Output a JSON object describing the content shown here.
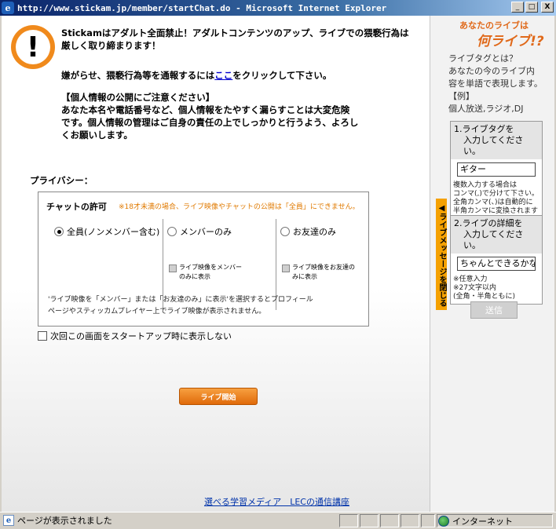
{
  "window": {
    "title": "http://www.stickam.jp/member/startChat.do - Microsoft Internet Explorer",
    "minimize": "_",
    "maximize": "□",
    "close": "X"
  },
  "notice": {
    "headline_1": "Stickamはアダルト全面禁止！アダルトコンテンツのアップ、ライブでの猥褻行為は",
    "headline_2": "厳しく取り締まります！",
    "report_before": "嫌がらせ、猥褻行為等を通報するには",
    "report_link": "ここ",
    "report_after": "をクリックして下さい。",
    "privacy_heading": "【個人情報の公開にご注意ください】",
    "privacy_1": "あなた本名や電話番号など、個人情報をたやすく漏らすことは大変危険",
    "privacy_2": "です。個人情報の管理はご自身の責任の上でしっかりと行うよう、よろし",
    "privacy_3": "くお願いします。"
  },
  "privacy": {
    "title": "プライバシー：",
    "chat_permission": "チャットの許可",
    "age_note": "※18才未満の場合、ライブ映像やチャットの公開は「全員」にできません。",
    "options": [
      {
        "label": "全員(ノンメンバー含む)",
        "selected": true
      },
      {
        "label": "メンバーのみ",
        "selected": false
      },
      {
        "label": "お友達のみ",
        "selected": false
      }
    ],
    "sub_members_1": "ライブ映像をメンバー",
    "sub_members_2": "のみに表示",
    "sub_friends_1": "ライブ映像をお友達の",
    "sub_friends_2": "みに表示",
    "desc_1": "'ライブ映像を「メンバー」または「お友達のみ」に表示'を選択するとプロフィール",
    "desc_2": "ページやスティッカムプレイヤー上でライブ映像が表示されません。"
  },
  "startup_checkbox": "次回この画面をスタートアップ時に表示しない",
  "live_start_button": "ライブ開始",
  "ad_link": "選べる学習メディア　LECの通信講座",
  "side": {
    "logo_line_1": "あなたのライブは",
    "logo_line_2": "何ライブ!?",
    "info_1": "ライブタグとは？",
    "info_2": "あなたの今のライブ内",
    "info_3": "容を単語で表現します。",
    "info_4": "【例】",
    "info_5": "個人放送,ラジオ,DJ",
    "tab_label": "◀ライブメッセージを閉じる",
    "step1_1": "1.ライブタグを",
    "step1_2": "入力してください。",
    "step1_value": "ギター",
    "step1_note_1": "複数入力する場合は",
    "step1_note_2": "コンマ(,)で分けて下さい。",
    "step1_note_3": "全角カンマ(、)は自動的に",
    "step1_note_4": "半角カンマに変換されます",
    "step2_1": "2.ライブの詳細を",
    "step2_2": "入力してください。",
    "step2_value": "ちゃんとできるかな",
    "step2_note_1": "※任意入力",
    "step2_note_2": "※27文字以内",
    "step2_note_3": "(全角・半角ともに)",
    "send_button": "送信"
  },
  "status": {
    "text": "ページが表示されました",
    "zone": "インターネット"
  }
}
